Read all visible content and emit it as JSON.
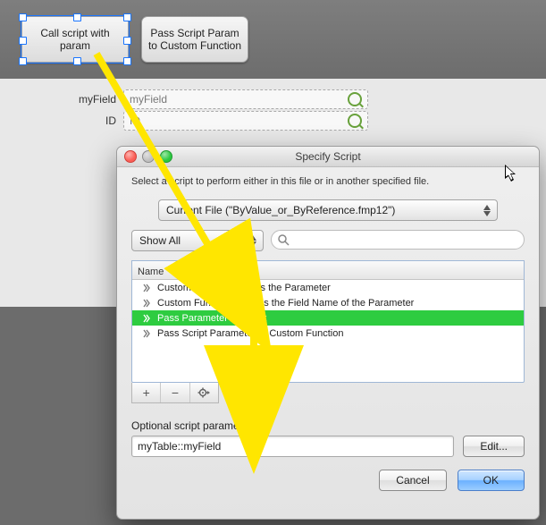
{
  "canvas": {
    "button1_label": "Call script with param",
    "button2_label": "Pass Script Param to Custom Function",
    "fields": [
      {
        "label": "myField",
        "value": "myField"
      },
      {
        "label": "ID",
        "value": "ID"
      }
    ]
  },
  "dialog": {
    "title": "Specify Script",
    "description": "Select a script to perform either in this file or in another specified file.",
    "file_popup": "Current File (\"ByValue_or_ByReference.fmp12\")",
    "filter_popup": "Show All",
    "list_header": "Name",
    "scripts": [
      "Custom Function Retuns the Parameter",
      "Custom Function Returns the Field Name of the Parameter",
      "Pass Parameter to Script",
      "Pass Script Parameter to Custom Function"
    ],
    "selected_index": 2,
    "toolbar": {
      "add": "+",
      "remove": "−",
      "gear": ""
    },
    "param_label": "Optional script parameter:",
    "param_value": "myTable::myField",
    "edit_btn": "Edit...",
    "cancel_btn": "Cancel",
    "ok_btn": "OK"
  }
}
